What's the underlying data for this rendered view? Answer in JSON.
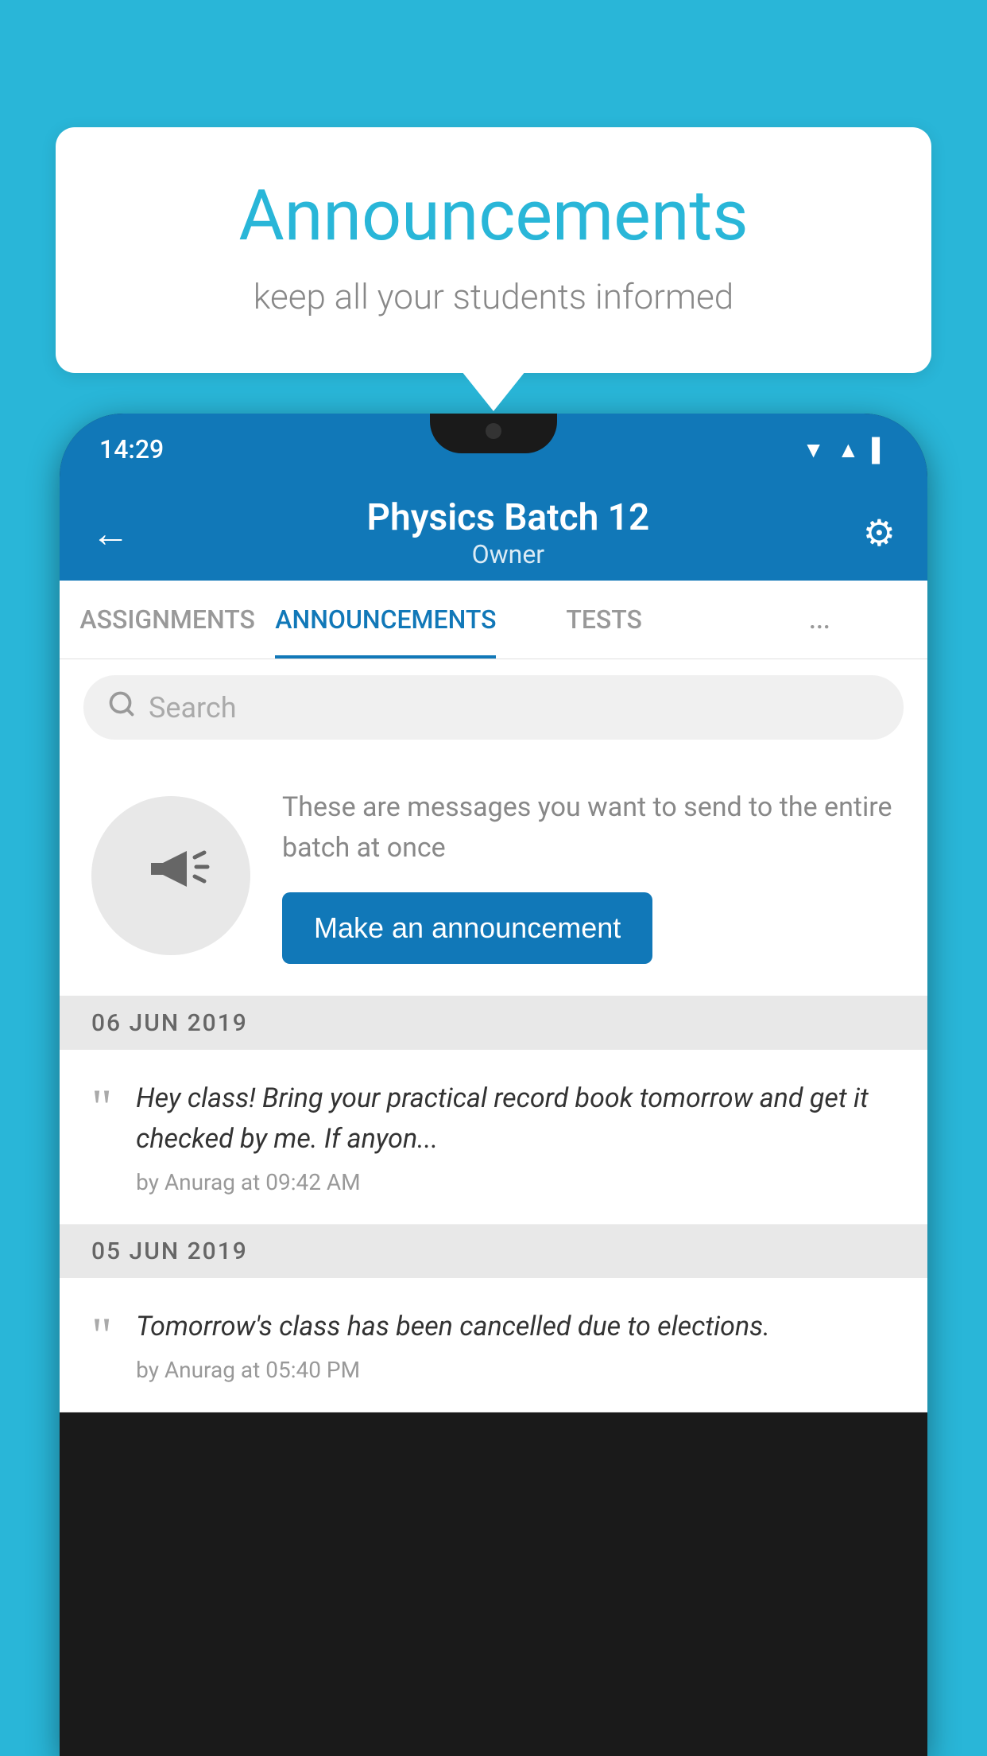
{
  "background_color": "#29B6D8",
  "bubble": {
    "title": "Announcements",
    "subtitle": "keep all your students informed"
  },
  "status_bar": {
    "time": "14:29",
    "icons": [
      "wifi",
      "signal",
      "battery"
    ]
  },
  "header": {
    "title": "Physics Batch 12",
    "subtitle": "Owner",
    "back_label": "←",
    "gear_label": "⚙"
  },
  "tabs": [
    {
      "label": "ASSIGNMENTS",
      "active": false
    },
    {
      "label": "ANNOUNCEMENTS",
      "active": true
    },
    {
      "label": "TESTS",
      "active": false
    },
    {
      "label": "...",
      "active": false
    }
  ],
  "search": {
    "placeholder": "Search"
  },
  "prompt": {
    "text": "These are messages you want to send to the entire batch at once",
    "button_label": "Make an announcement"
  },
  "announcements": [
    {
      "date": "06  JUN  2019",
      "message": "Hey class! Bring your practical record book tomorrow and get it checked by me. If anyon...",
      "meta": "by Anurag at 09:42 AM"
    },
    {
      "date": "05  JUN  2019",
      "message": "Tomorrow's class has been cancelled due to elections.",
      "meta": "by Anurag at 05:40 PM"
    }
  ]
}
